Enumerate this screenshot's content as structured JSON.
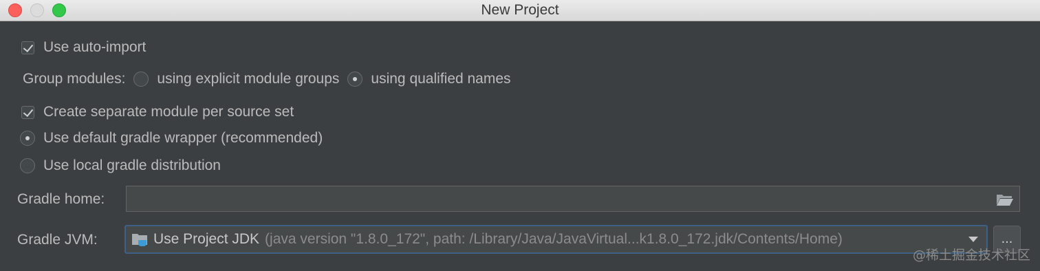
{
  "window": {
    "title": "New Project"
  },
  "auto_import": {
    "label": "Use auto-import",
    "checked": true
  },
  "group_modules": {
    "label": "Group modules:",
    "option1": "using explicit module groups",
    "option2": "using qualified names",
    "selected": "using qualified names"
  },
  "separate_module": {
    "label": "Create separate module per source set",
    "checked": true
  },
  "gradle_wrapper": {
    "label": "Use default gradle wrapper (recommended)",
    "selected": true
  },
  "local_gradle": {
    "label": "Use local gradle distribution",
    "selected": false
  },
  "gradle_home": {
    "label": "Gradle home:",
    "value": ""
  },
  "gradle_jvm": {
    "label": "Gradle JVM:",
    "selected_main": "Use Project JDK",
    "selected_detail": "(java version \"1.8.0_172\", path: /Library/Java/JavaVirtual...k1.8.0_172.jdk/Contents/Home)",
    "browse_label": "..."
  },
  "watermark": "@稀土掘金技术社区",
  "icons": {
    "gradle_home_browse": "folder-open-icon",
    "jdk": "jdk-folder-icon",
    "combo_arrow": "chevron-down-icon"
  }
}
